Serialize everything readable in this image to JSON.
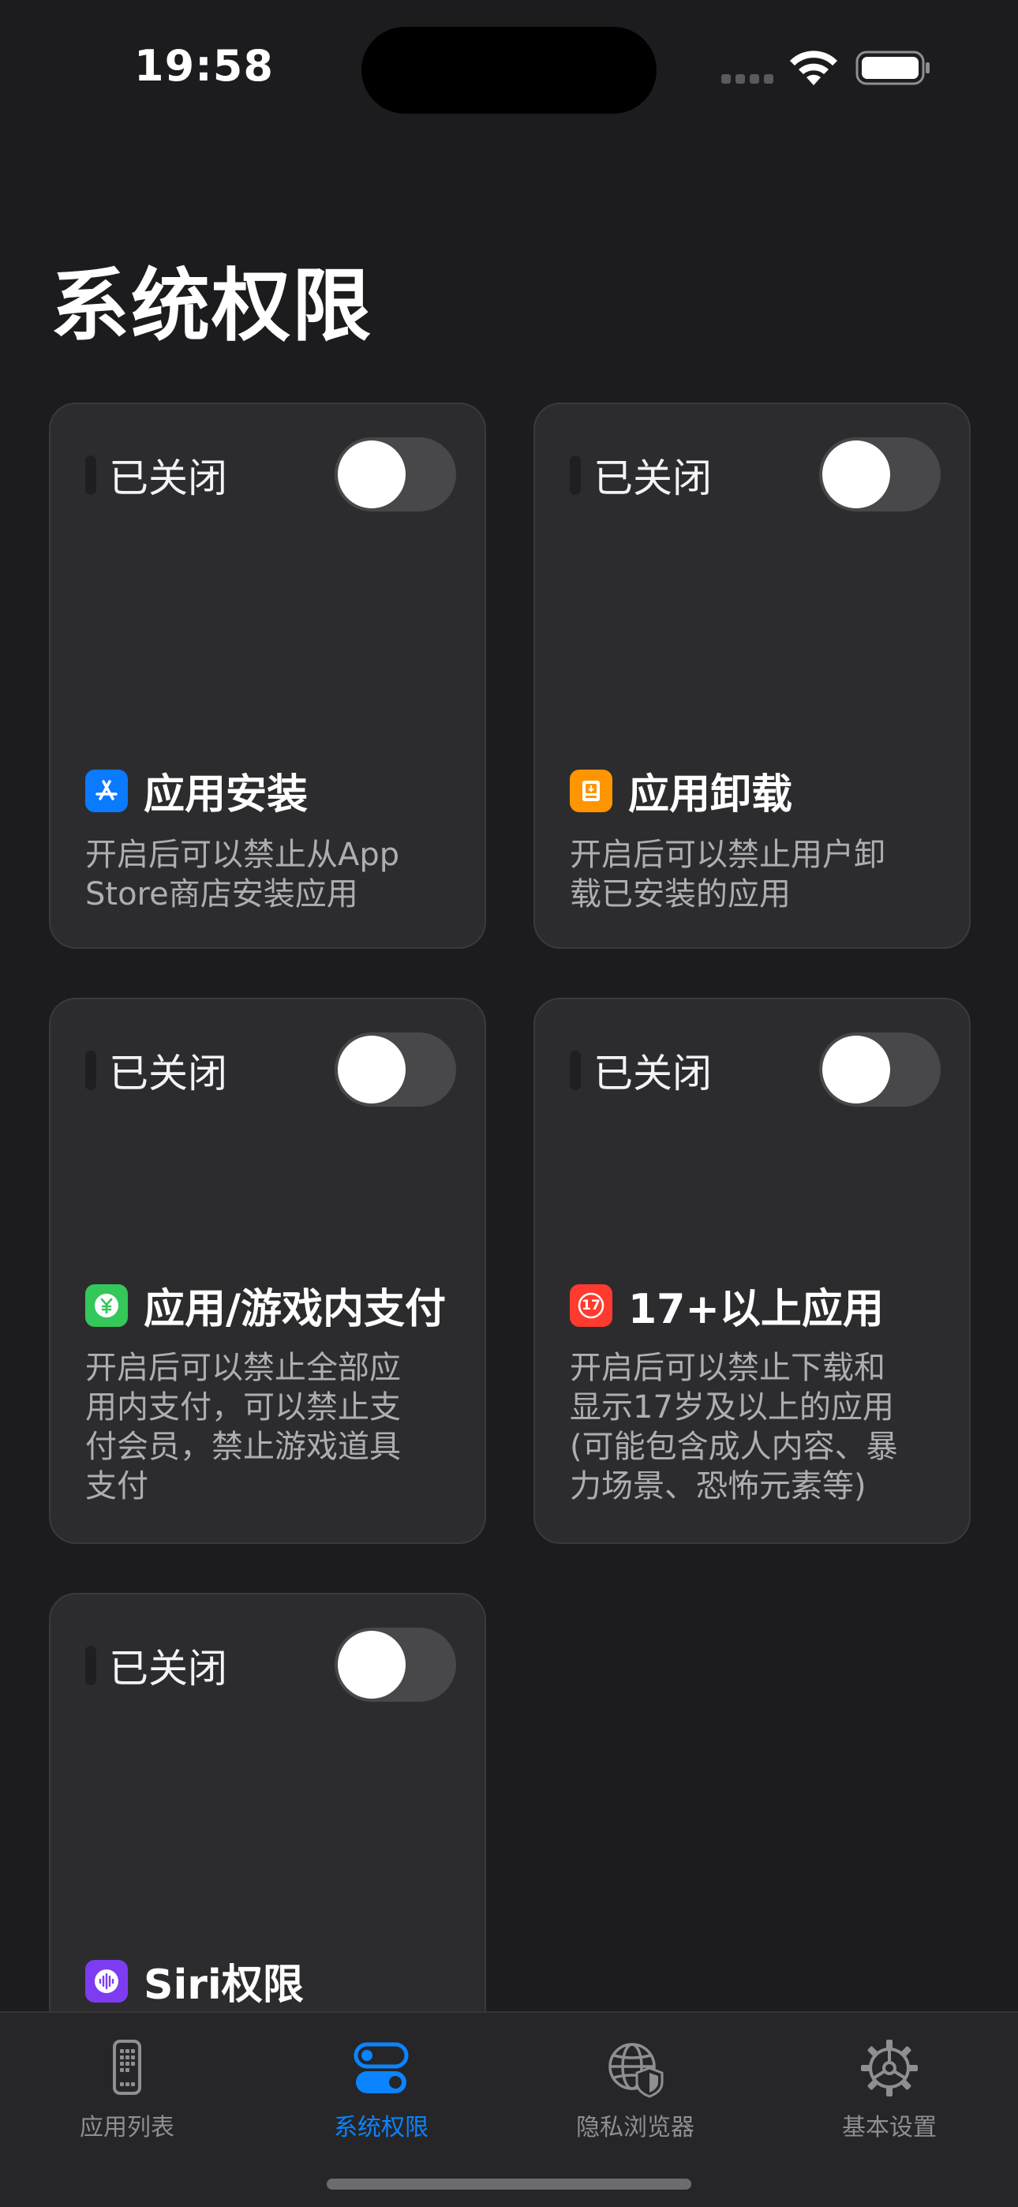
{
  "status_bar": {
    "time": "19:58"
  },
  "page_title": "系统权限",
  "cards": [
    {
      "status": "已关闭",
      "enabled": false,
      "title": "应用安装",
      "icon": "app-store-icon",
      "icon_color": "#0a7aff",
      "description": [
        "开启后可以禁止从App",
        "Store商店安装应用"
      ]
    },
    {
      "status": "已关闭",
      "enabled": false,
      "title": "应用卸载",
      "icon": "uninstall-box-icon",
      "icon_color": "#ff9500",
      "description": [
        "开启后可以禁止用户卸",
        "载已安装的应用"
      ]
    },
    {
      "status": "已关闭",
      "enabled": false,
      "title": "应用/游戏内支付",
      "icon": "payment-yuan-icon",
      "icon_color": "#34c759",
      "description": [
        "开启后可以禁止全部应",
        "用内支付，可以禁止支",
        "付会员，禁止游戏道具",
        "支付"
      ]
    },
    {
      "status": "已关闭",
      "enabled": false,
      "title": "17+以上应用",
      "icon": "age-17-icon",
      "icon_color": "#ff3b30",
      "icon_text": "17",
      "description": [
        "开启后可以禁止下载和",
        "显示17岁及以上的应用",
        "(可能包含成人内容、暴",
        "力场景、恐怖元素等)"
      ]
    },
    {
      "status": "已关闭",
      "enabled": false,
      "title": "Siri权限",
      "icon": "siri-waveform-icon",
      "icon_color": "#7d3cf0",
      "description": []
    }
  ],
  "tabs": [
    {
      "label": "应用列表",
      "icon": "phone-grid-icon",
      "active": false
    },
    {
      "label": "系统权限",
      "icon": "toggles-icon",
      "active": true
    },
    {
      "label": "隐私浏览器",
      "icon": "globe-shield-icon",
      "active": false
    },
    {
      "label": "基本设置",
      "icon": "gear-icon",
      "active": false
    }
  ],
  "colors": {
    "background": "#1c1c1e",
    "card": "#2c2c2e",
    "accent": "#0a84ff",
    "tab_inactive": "#8e8e93"
  }
}
